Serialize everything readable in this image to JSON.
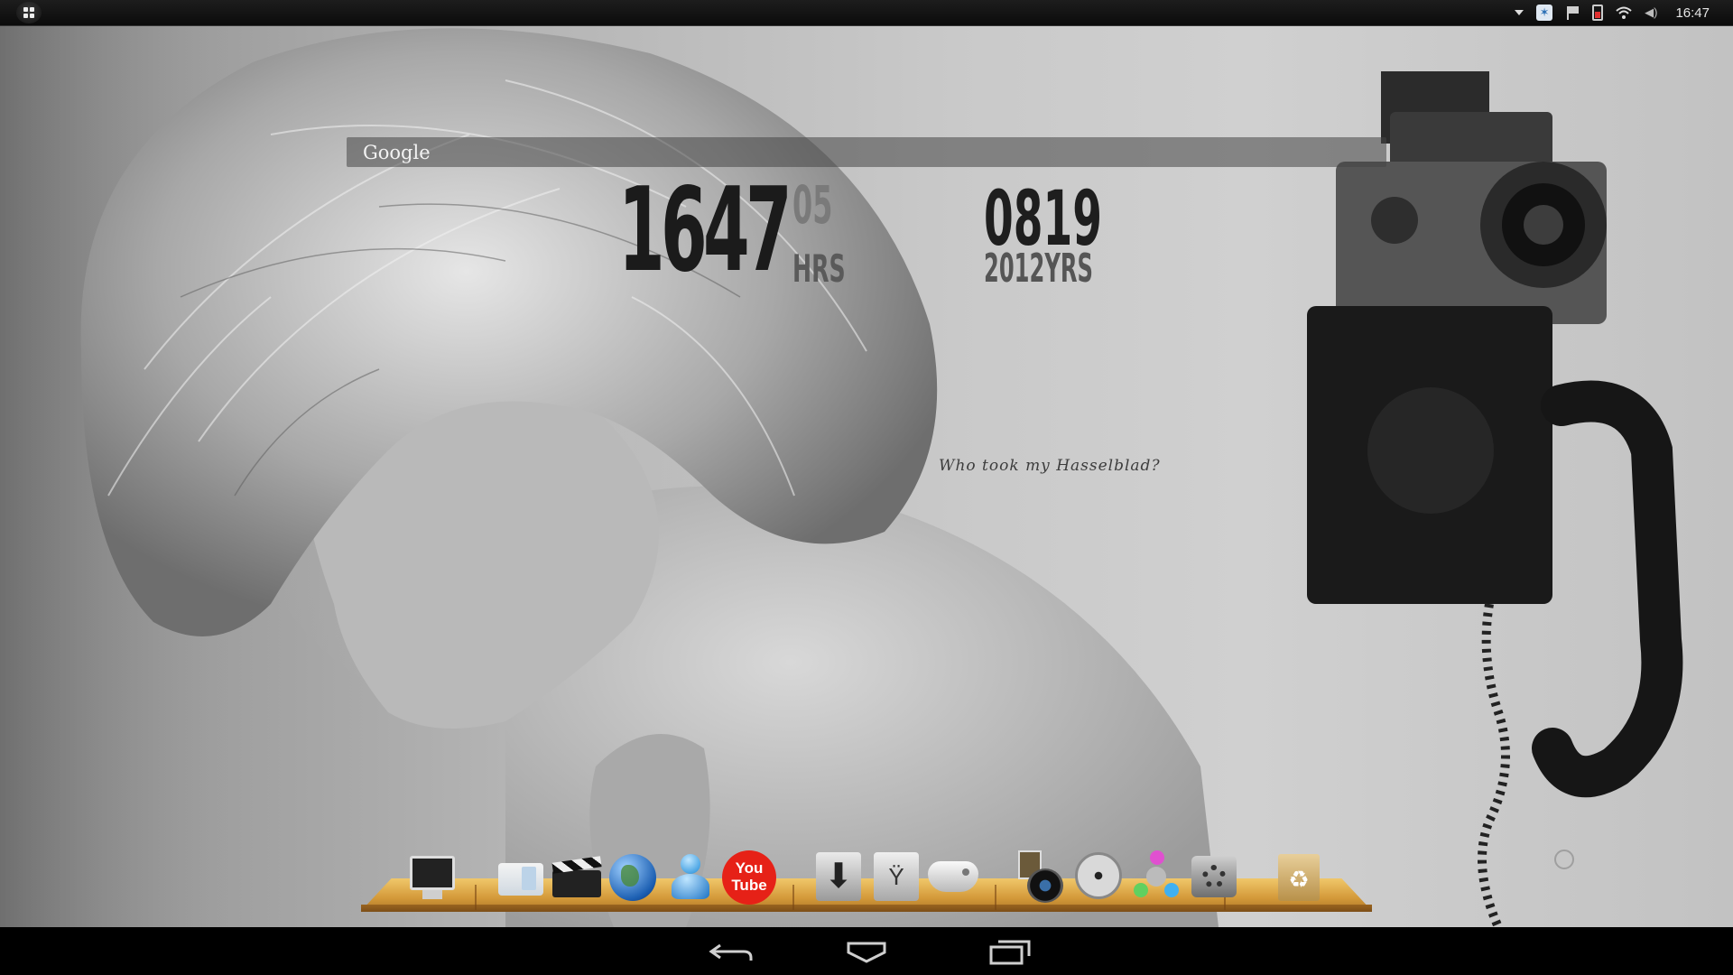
{
  "status_bar": {
    "start_icon": "windows-logo-icon",
    "tray_icons": [
      "dropdown-arrow-icon",
      "app-notification-icon",
      "flag-icon",
      "battery-icon",
      "wifi-icon",
      "volume-icon"
    ],
    "time": "16:47"
  },
  "search": {
    "label": "Google"
  },
  "clock_widget": {
    "time": "1647",
    "seconds": "05",
    "hours_label": "HRS",
    "date": "0819",
    "year_label": "2012YRS"
  },
  "tagline": "Who took my Hasselblad?",
  "dock": {
    "items": [
      {
        "name": "computer-monitor",
        "icon": "monitor-icon"
      },
      {
        "name": "finder",
        "icon": "finder-icon"
      },
      {
        "name": "video-clapper",
        "icon": "clapperboard-icon"
      },
      {
        "name": "browser-globe",
        "icon": "globe-icon"
      },
      {
        "name": "messenger",
        "icon": "messenger-person-icon"
      },
      {
        "name": "youtube",
        "icon": "youtube-icon",
        "label": "You Tube"
      },
      {
        "name": "downloads",
        "icon": "download-arrow-icon"
      },
      {
        "name": "firewire-drive",
        "icon": "usb-drive-icon"
      },
      {
        "name": "game-controller",
        "icon": "gamepad-icon"
      },
      {
        "name": "photo-camera",
        "icon": "photo-camera-icon"
      },
      {
        "name": "media-player",
        "icon": "film-reel-icon"
      },
      {
        "name": "network",
        "icon": "network-nodes-icon"
      },
      {
        "name": "system-settings",
        "icon": "settings-gears-icon"
      },
      {
        "name": "trash",
        "icon": "recycle-bin-icon"
      }
    ]
  },
  "nav_bar": {
    "buttons": [
      "back-icon",
      "home-icon",
      "recent-apps-icon"
    ]
  },
  "colors": {
    "shelf_wood": "#d49a3a",
    "youtube_red": "#e62117",
    "status_bar_bg": "#111111"
  }
}
